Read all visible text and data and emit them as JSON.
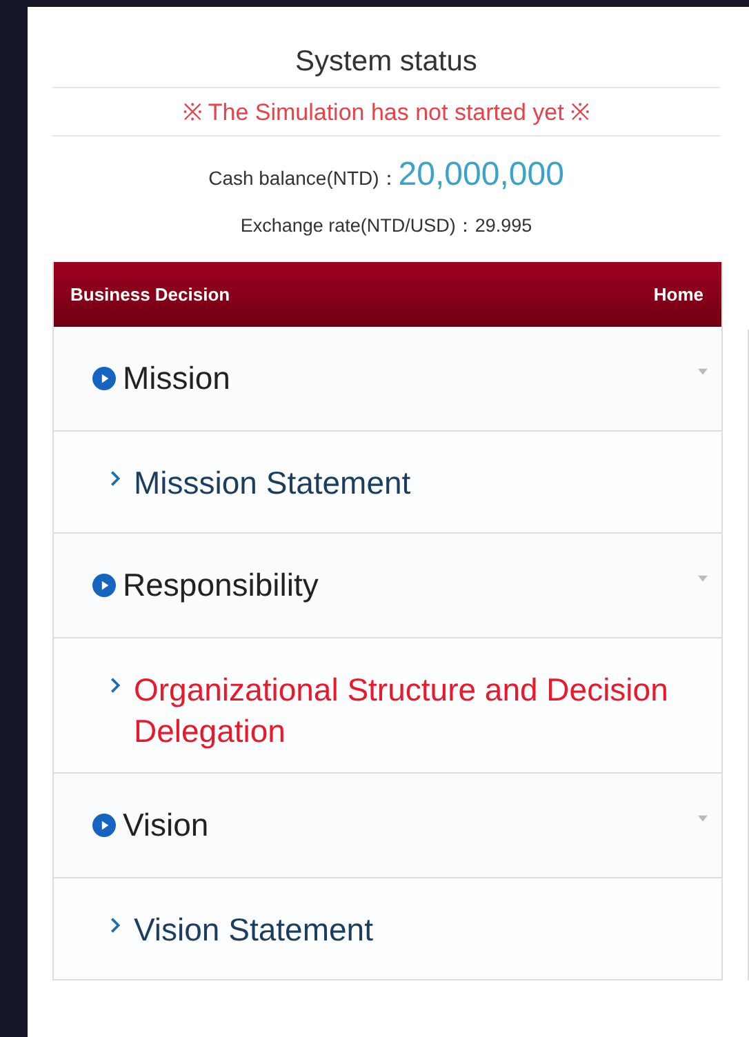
{
  "status": {
    "title": "System status",
    "notice": "※ The Simulation has not started yet ※",
    "cash_label": "Cash balance(NTD)：",
    "cash_value": "20,000,000",
    "exchange": "Exchange rate(NTD/USD)：29.995"
  },
  "menu": {
    "title": "Business Decision",
    "home": "Home",
    "sections": [
      {
        "title": "Mission",
        "expanded": true,
        "children": [
          {
            "label": "Misssion Statement",
            "selected": false
          }
        ]
      },
      {
        "title": "Responsibility",
        "expanded": true,
        "children": [
          {
            "label": "Organizational Structure and Decision Delegation",
            "selected": true
          }
        ]
      },
      {
        "title": "Vision",
        "expanded": true,
        "children": [
          {
            "label": "Vision Statement",
            "selected": false
          }
        ]
      }
    ]
  }
}
